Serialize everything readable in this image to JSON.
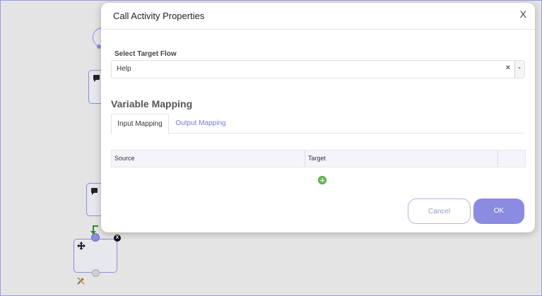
{
  "dialog": {
    "title": "Call Activity Properties",
    "close_label": "X",
    "target_flow_label": "Select Target Flow",
    "target_flow_value": "Help",
    "clear_label": "×",
    "section_title": "Variable Mapping",
    "tabs": [
      {
        "label": "Input Mapping",
        "active": true
      },
      {
        "label": "Output Mapping",
        "active": false
      }
    ],
    "grid_headers": [
      "Source",
      "Target"
    ],
    "cancel_label": "Cancel",
    "ok_label": "OK"
  },
  "canvas": {
    "node_delete_label": "X"
  },
  "colors": {
    "accent": "#8b8be2",
    "link": "#7b7bd6",
    "add_icon": "#6fbf5a",
    "border": "#9a9ae6"
  }
}
